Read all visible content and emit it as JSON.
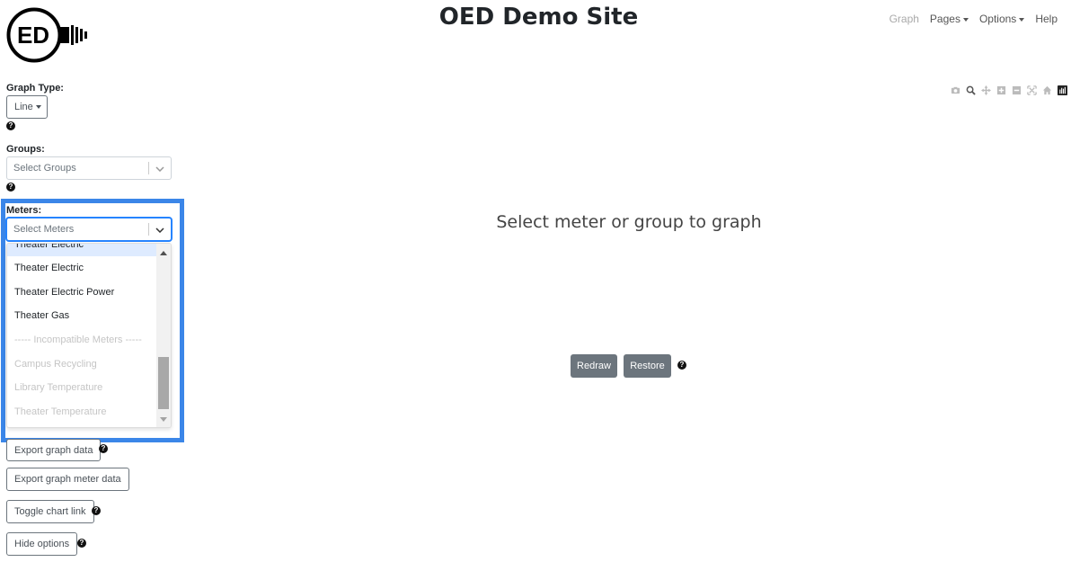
{
  "header": {
    "logo_text": "ED",
    "title": "OED Demo Site",
    "nav": [
      {
        "label": "Graph",
        "active": true,
        "dropdown": false
      },
      {
        "label": "Pages",
        "active": false,
        "dropdown": true
      },
      {
        "label": "Options",
        "active": false,
        "dropdown": true
      },
      {
        "label": "Help",
        "active": false,
        "dropdown": false
      }
    ]
  },
  "sidebar": {
    "graph_type_label": "Graph Type:",
    "graph_type_value": "Line",
    "groups_label": "Groups:",
    "groups_placeholder": "Select Groups",
    "meters_label": "Meters:",
    "meters_placeholder": "Select Meters",
    "meters_menu": [
      {
        "label": "Theater Electric",
        "disabled": false,
        "partial": true
      },
      {
        "label": "Theater Electric",
        "disabled": false
      },
      {
        "label": "Theater Electric Power",
        "disabled": false
      },
      {
        "label": "Theater Gas",
        "disabled": false
      },
      {
        "label": "----- Incompatible Meters -----",
        "disabled": true
      },
      {
        "label": "Campus Recycling",
        "disabled": true
      },
      {
        "label": "Library Temperature",
        "disabled": true
      },
      {
        "label": "Theater Temperature",
        "disabled": true
      }
    ],
    "buttons": {
      "export_graph_data": "Export graph data",
      "export_meter_data": "Export graph meter data",
      "toggle_chart_link": "Toggle chart link",
      "hide_options": "Hide options"
    },
    "help_glyph": "?"
  },
  "main": {
    "empty_message": "Select meter or group to graph",
    "redraw_label": "Redraw",
    "restore_label": "Restore"
  },
  "modebar": {
    "icons": [
      "camera-icon",
      "zoom-icon",
      "pan-icon",
      "zoom-in-icon",
      "zoom-out-icon",
      "autoscale-icon",
      "reset-axes-icon",
      "plotly-logo-icon"
    ]
  },
  "colors": {
    "highlight": "#3b86e8",
    "dark_button": "#6c757d",
    "focus": "#2684ff"
  }
}
